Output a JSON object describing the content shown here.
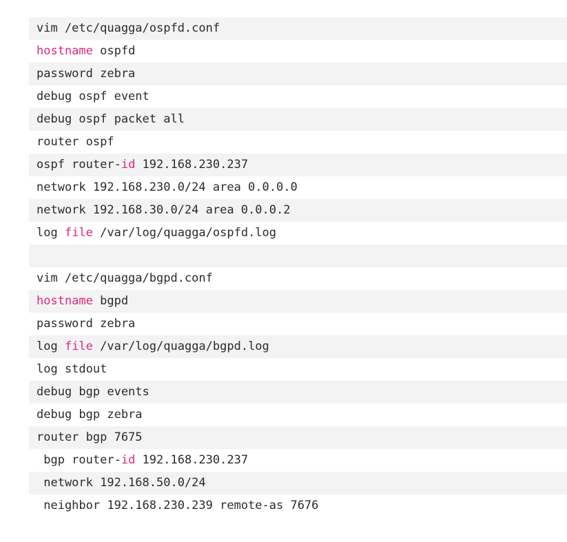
{
  "code_block": {
    "lines": [
      [
        {
          "t": "vim /etc/quagga/ospfd.conf"
        }
      ],
      [
        {
          "t": "hostname",
          "kw": true
        },
        {
          "t": " ospfd"
        }
      ],
      [
        {
          "t": "password zebra"
        }
      ],
      [
        {
          "t": "debug ospf event"
        }
      ],
      [
        {
          "t": "debug ospf packet all"
        }
      ],
      [
        {
          "t": "router ospf"
        }
      ],
      [
        {
          "t": "ospf router-"
        },
        {
          "t": "id",
          "kw": true
        },
        {
          "t": " 192.168.230.237"
        }
      ],
      [
        {
          "t": "network 192.168.230.0/24 area 0.0.0.0"
        }
      ],
      [
        {
          "t": "network 192.168.30.0/24 area 0.0.0.2"
        }
      ],
      [
        {
          "t": "log "
        },
        {
          "t": "file",
          "kw": true
        },
        {
          "t": " /var/log/quagga/ospfd.log"
        }
      ],
      [
        {
          "t": ""
        }
      ],
      [
        {
          "t": "vim /etc/quagga/bgpd.conf"
        }
      ],
      [
        {
          "t": "hostname",
          "kw": true
        },
        {
          "t": " bgpd"
        }
      ],
      [
        {
          "t": "password zebra"
        }
      ],
      [
        {
          "t": "log "
        },
        {
          "t": "file",
          "kw": true
        },
        {
          "t": " /var/log/quagga/bgpd.log"
        }
      ],
      [
        {
          "t": "log stdout"
        }
      ],
      [
        {
          "t": "debug bgp events"
        }
      ],
      [
        {
          "t": "debug bgp zebra"
        }
      ],
      [
        {
          "t": "router bgp 7675"
        }
      ],
      [
        {
          "t": " bgp router-"
        },
        {
          "t": "id",
          "kw": true
        },
        {
          "t": " 192.168.230.237"
        }
      ],
      [
        {
          "t": " network 192.168.50.0/24"
        }
      ],
      [
        {
          "t": " neighbor 192.168.230.239 remote-as 7676"
        }
      ]
    ]
  },
  "colors": {
    "keyword": "#e0287d",
    "text": "#2b2b2b",
    "stripe": "#f3f3f3",
    "background": "#ffffff"
  }
}
